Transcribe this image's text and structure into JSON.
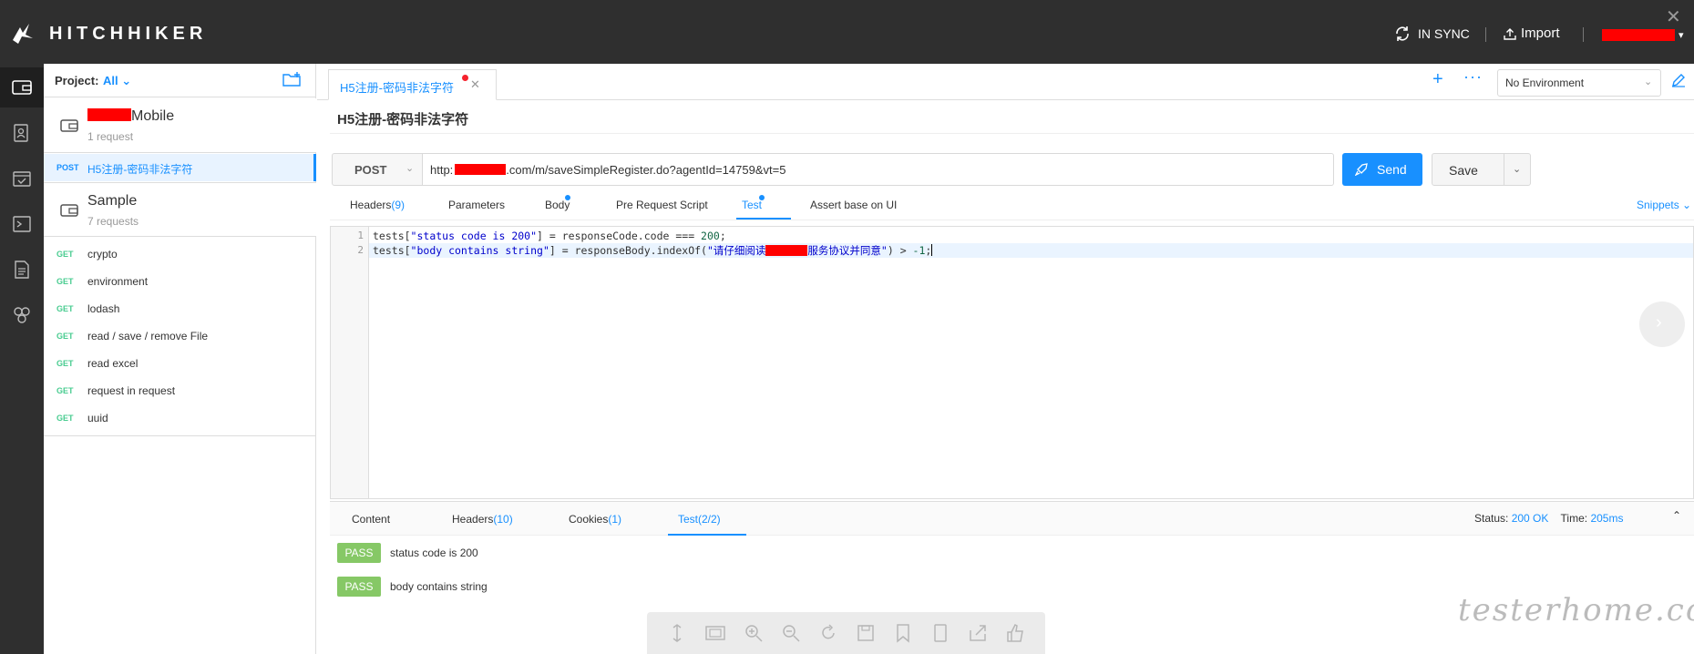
{
  "app": {
    "name": "HITCHHIKER",
    "sync_status": "IN SYNC",
    "import_label": "Import"
  },
  "sidebar": {
    "project_label": "Project:",
    "project_value": "All",
    "collections": [
      {
        "name": "Mobile",
        "count": "1 request"
      },
      {
        "name": "Sample",
        "count": "7 requests"
      }
    ],
    "selected_request": {
      "method": "POST",
      "name": "H5注册-密码非法字符"
    },
    "sample_requests": [
      {
        "method": "GET",
        "name": "crypto"
      },
      {
        "method": "GET",
        "name": "environment"
      },
      {
        "method": "GET",
        "name": "lodash"
      },
      {
        "method": "GET",
        "name": "read / save / remove File"
      },
      {
        "method": "GET",
        "name": "read excel"
      },
      {
        "method": "GET",
        "name": "request in request"
      },
      {
        "method": "GET",
        "name": "uuid"
      }
    ]
  },
  "tabs": {
    "open_tab": "H5注册-密码非法字符",
    "environment": "No Environment"
  },
  "request": {
    "title": "H5注册-密码非法字符",
    "method": "POST",
    "url_prefix": "http:",
    "url_suffix": ".com/m/saveSimpleRegister.do?agentId=14759&vt=5",
    "send_label": "Send",
    "save_label": "Save",
    "subtabs": {
      "headers": "Headers",
      "headers_count": "(9)",
      "parameters": "Parameters",
      "body": "Body",
      "pre_request": "Pre Request Script",
      "test": "Test",
      "assert": "Assert base on UI"
    },
    "snippets_label": "Snippets",
    "code": {
      "line1_no": "1",
      "line2_no": "2",
      "l1_a": "tests[",
      "l1_b": "\"status code is 200\"",
      "l1_c": "] = responseCode.code === ",
      "l1_d": "200",
      "l1_e": ";",
      "l2_a": "tests[",
      "l2_b": "\"body contains string\"",
      "l2_c": "] = responseBody.indexOf(",
      "l2_d1": "\"请仔细阅读",
      "l2_d2": "服务协议并同意\"",
      "l2_e": ") > ",
      "l2_f": "-1",
      "l2_g": ";"
    }
  },
  "response": {
    "tabs": {
      "content": "Content",
      "headers": "Headers",
      "headers_count": "(10)",
      "cookies": "Cookies",
      "cookies_count": "(1)",
      "test": "Test(2/2)"
    },
    "status_label": "Status:",
    "status_value": "200 OK",
    "time_label": "Time:",
    "time_value": "205ms",
    "results": [
      {
        "badge": "PASS",
        "name": "status code is 200"
      },
      {
        "badge": "PASS",
        "name": "body contains string"
      }
    ]
  },
  "watermark": "testerhome.com",
  "colors": {
    "primary": "#1890ff",
    "header_bg": "#2f2f2f",
    "get_method": "#49cc90",
    "pass_badge": "#86c866"
  }
}
